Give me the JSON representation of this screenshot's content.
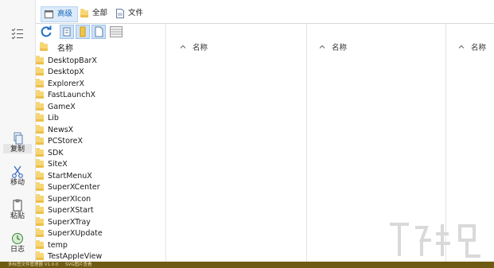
{
  "tabs": [
    {
      "label": "高级",
      "icon": "window-icon",
      "active": true
    },
    {
      "label": "全部",
      "icon": "folder-icon",
      "active": false
    },
    {
      "label": "文件",
      "icon": "document-icon",
      "active": false
    }
  ],
  "left_toolbar": {
    "copy_label": "复制",
    "move_label": "移动",
    "paste_label": "粘贴",
    "log_label": "日志"
  },
  "panes": [
    {
      "header": "名称"
    },
    {
      "header": "名称"
    },
    {
      "header": "名称"
    },
    {
      "header": "名称"
    }
  ],
  "files": [
    "DesktopBarX",
    "DesktopX",
    "ExplorerX",
    "FastLaunchX",
    "GameX",
    "Lib",
    "NewsX",
    "PCStoreX",
    "SDK",
    "SiteX",
    "StartMenuX",
    "SuperXCenter",
    "SuperXIcon",
    "SuperXStart",
    "SuperXTray",
    "SuperXUpdate",
    "temp",
    "TestAppleView"
  ],
  "status": {
    "left": "多标签文件管理器 V1.0.0",
    "right": "SVG图片查看"
  },
  "colors": {
    "accent": "#1a66b5",
    "folder": "#f6d675",
    "statusbar": "#6e5a12"
  }
}
